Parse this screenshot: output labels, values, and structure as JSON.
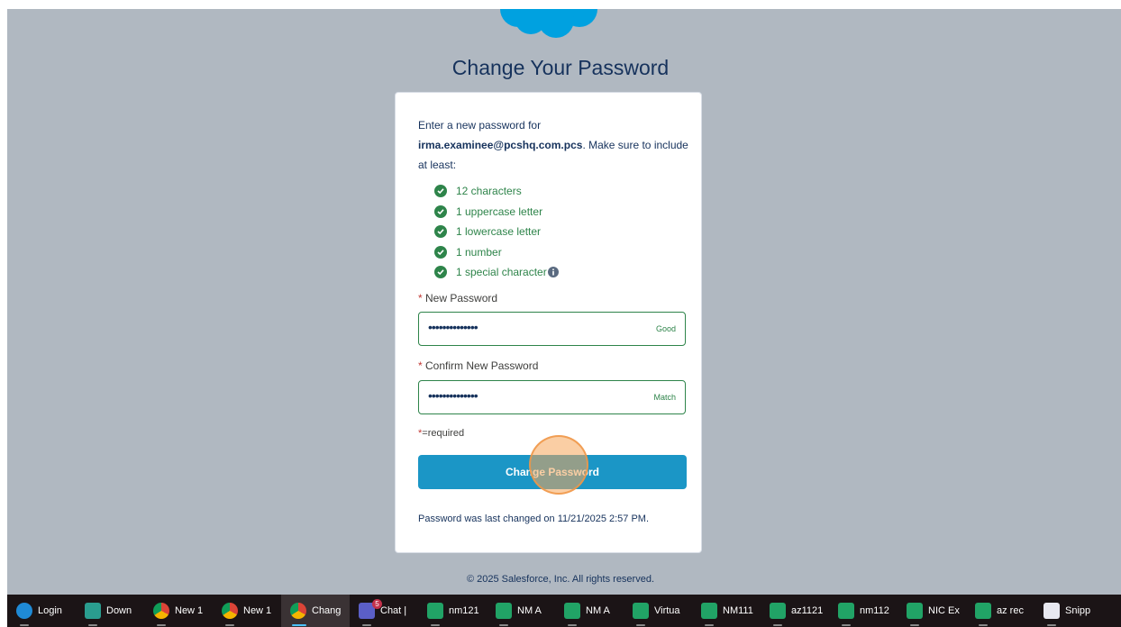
{
  "page": {
    "title": "Change Your Password",
    "intro_prefix": "Enter a new password for",
    "username": "irma.examinee@pcshq.com.pcs",
    "intro_suffix": ". Make sure to include at least:",
    "rules": [
      "12 characters",
      "1 uppercase letter",
      "1 lowercase letter",
      "1 number",
      "1 special character"
    ],
    "new_password_label": "New Password",
    "new_password_value": "••••••••••••••",
    "new_password_status": "Good",
    "confirm_password_label": "Confirm New Password",
    "confirm_password_value": "••••••••••••••",
    "confirm_password_status": "Match",
    "required_star": "*",
    "required_note": "=required",
    "button_label": "Change Password",
    "last_changed": "Password was last changed on 11/21/2025 2:57 PM.",
    "footer": "© 2025 Salesforce, Inc. All rights reserved."
  },
  "colors": {
    "background": "#b0b8c1",
    "accent": "#1b96c6",
    "success": "#2e844a",
    "required": "#c23934"
  },
  "taskbar": {
    "items": [
      {
        "label": "Login",
        "icon": "edge-icon"
      },
      {
        "label": "Down",
        "icon": "downloads-icon"
      },
      {
        "label": "New 1",
        "icon": "chrome-icon"
      },
      {
        "label": "New 1",
        "icon": "chrome-icon"
      },
      {
        "label": "Chang",
        "icon": "chrome-icon"
      },
      {
        "label": "Chat |",
        "icon": "teams-icon",
        "badge": "5"
      },
      {
        "label": "nm121",
        "icon": "excel-icon"
      },
      {
        "label": "NM A",
        "icon": "excel-icon"
      },
      {
        "label": "NM A",
        "icon": "excel-icon"
      },
      {
        "label": "Virtua",
        "icon": "excel-icon"
      },
      {
        "label": "NM111",
        "icon": "excel-icon"
      },
      {
        "label": "az1121",
        "icon": "excel-icon"
      },
      {
        "label": "nm112",
        "icon": "excel-icon"
      },
      {
        "label": "NIC Ex",
        "icon": "excel-icon"
      },
      {
        "label": "az rec",
        "icon": "excel-icon"
      },
      {
        "label": "Snipp",
        "icon": "snipping-tool-icon"
      }
    ]
  }
}
